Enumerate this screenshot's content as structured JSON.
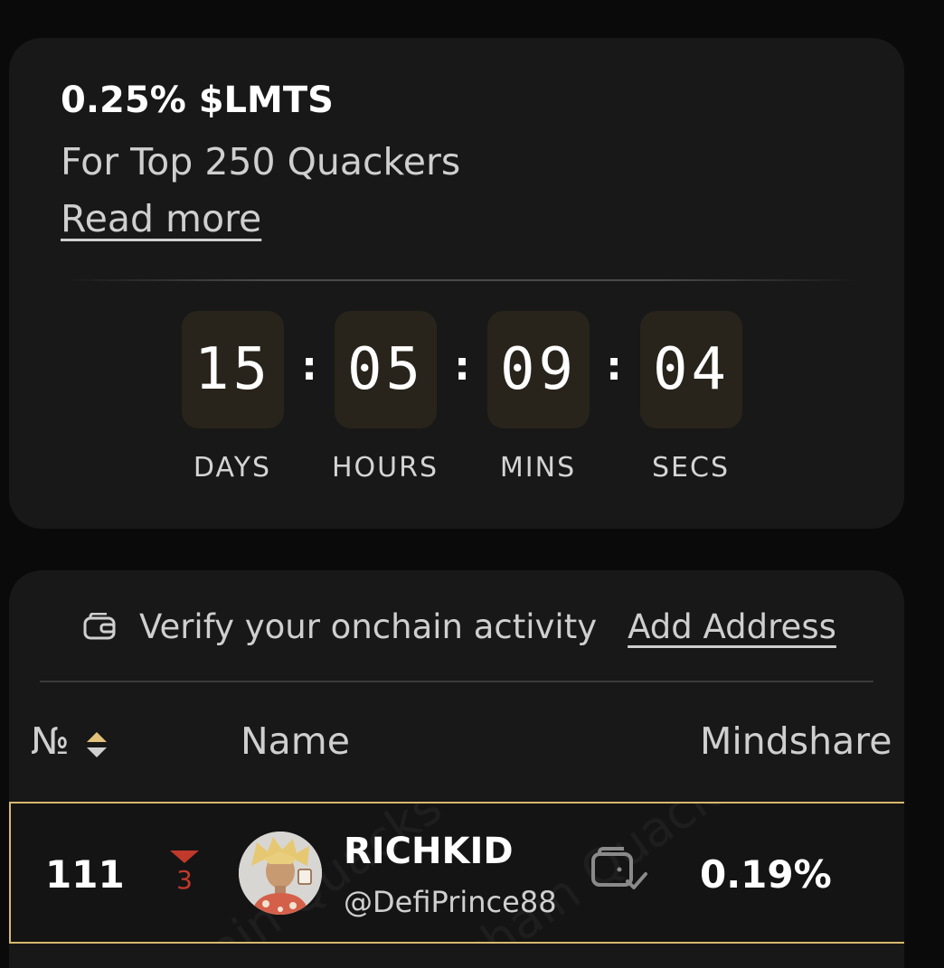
{
  "reward": {
    "title": "0.25% $LMTS",
    "subtitle": "For Top 250 Quackers",
    "read_more": "Read more"
  },
  "countdown": {
    "days": "15",
    "hours": "05",
    "mins": "09",
    "secs": "04",
    "separator": ":",
    "labels": {
      "days": "DAYS",
      "hours": "HOURS",
      "mins": "MINS",
      "secs": "SECS"
    }
  },
  "verify": {
    "text": "Verify your onchain activity",
    "link": "Add Address",
    "icon": "wallet-icon"
  },
  "table": {
    "headers": {
      "rank": "№",
      "name": "Name",
      "mindshare": "Mindshare"
    },
    "rows": [
      {
        "rank": "111",
        "change": "3",
        "change_direction": "down",
        "name": "RICHKID",
        "handle": "@DefiPrince88",
        "wallet_verified": true,
        "mindshare": "0.19%"
      }
    ]
  },
  "colors": {
    "background": "#0a0a0a",
    "card": "#181818",
    "countdown_box": "#28241b",
    "highlight_border": "#d8b86c",
    "rank_down": "#c0392b",
    "sort_icon": "#e2c27a"
  }
}
